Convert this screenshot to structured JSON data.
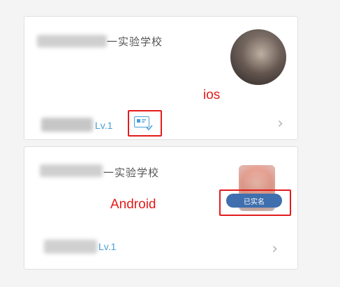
{
  "cards": [
    {
      "school_name": "一实验学校",
      "level": "Lv.1",
      "platform_label": "ios",
      "badge_icon": "id-card-check-icon",
      "chevron": "›"
    },
    {
      "school_name": "一实验学校",
      "level": "Lv.1",
      "platform_label": "Android",
      "badge_text": "已实名",
      "chevron": "›"
    }
  ],
  "colors": {
    "accent_blue": "#4a9fd8",
    "annotation_red": "#e31b1b",
    "badge_blue": "#3f6fae"
  }
}
